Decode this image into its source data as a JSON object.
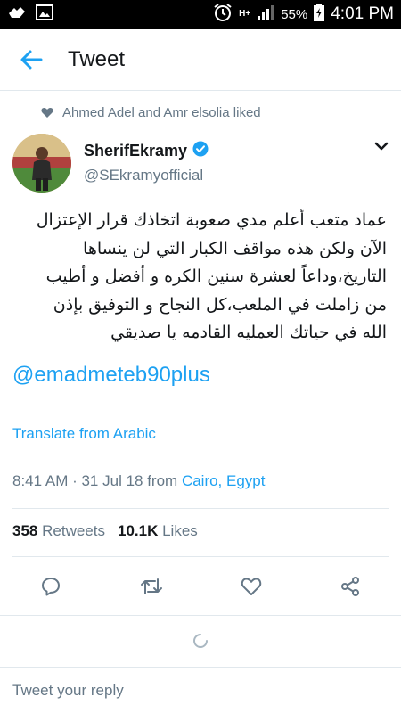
{
  "status_bar": {
    "network_label": "H+",
    "battery_percent": "55%",
    "time": "4:01 PM"
  },
  "app_bar": {
    "title": "Tweet"
  },
  "social_context": {
    "text": "Ahmed Adel and Amr elsolia liked"
  },
  "author": {
    "display_name": "SherifEkramy",
    "handle": "@SEkramyofficial",
    "verified": true
  },
  "tweet": {
    "lines": [
      "عماد متعب أعلم مدي صعوبة اتخاذك قرار الإعتزال",
      "الآن ولكن هذه مواقف الكبار التي لن ينساها",
      "التاريخ،وداعاً لعشرة سنين الكره و أفضل و أطيب",
      "من زاملت في الملعب،كل النجاح و التوفيق بإذن",
      "الله في حياتك العمليه القادمه يا صديقي"
    ],
    "mention": "@emadmeteb90plus",
    "translate_label": "Translate from Arabic",
    "timestamp": "8:41 AM · 31 Jul 18 from",
    "location": "Cairo, Egypt"
  },
  "stats": {
    "retweets_count": "358",
    "retweets_label": "Retweets",
    "likes_count": "10.1K",
    "likes_label": "Likes"
  },
  "reply": {
    "placeholder": "Tweet your reply"
  },
  "colors": {
    "accent": "#1da1f2",
    "secondary_text": "#657786",
    "divider": "#e1e8ed"
  }
}
